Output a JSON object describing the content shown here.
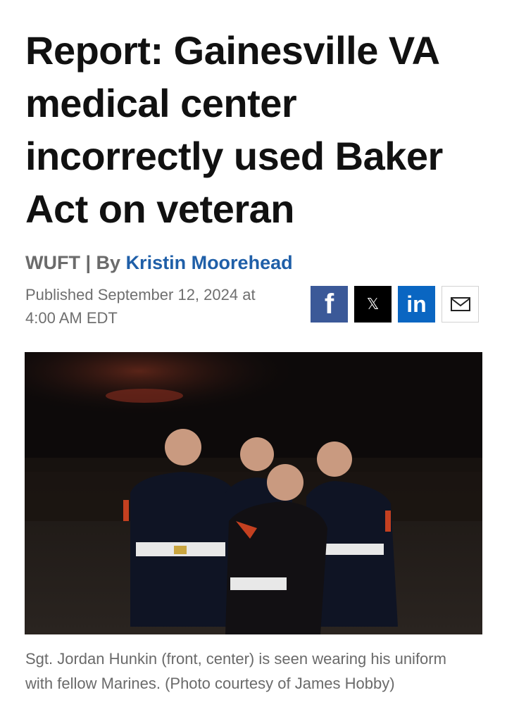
{
  "headline": "Report: Gainesville VA medical center incorrectly used Baker Act on veteran",
  "byline": {
    "source": "WUFT",
    "separator": " | ",
    "by": "By ",
    "author": "Kristin Moorehead"
  },
  "published": {
    "line1": "Published September 12, 2024 at",
    "line2": "4:00 AM EDT"
  },
  "share": [
    {
      "label": "f",
      "icon": "facebook-icon",
      "color": "#3b5998"
    },
    {
      "label": "𝕏",
      "icon": "x-icon",
      "color": "#000000"
    },
    {
      "label": "in",
      "icon": "linkedin-icon",
      "color": "#0a66c2"
    },
    {
      "label": "",
      "icon": "email-icon",
      "color": "#ffffff"
    }
  ],
  "photo": {
    "caption": "Sgt. Jordan Hunkin (front, center) is seen wearing his uniform with fellow Marines. (Photo courtesy of James Hobby)"
  }
}
